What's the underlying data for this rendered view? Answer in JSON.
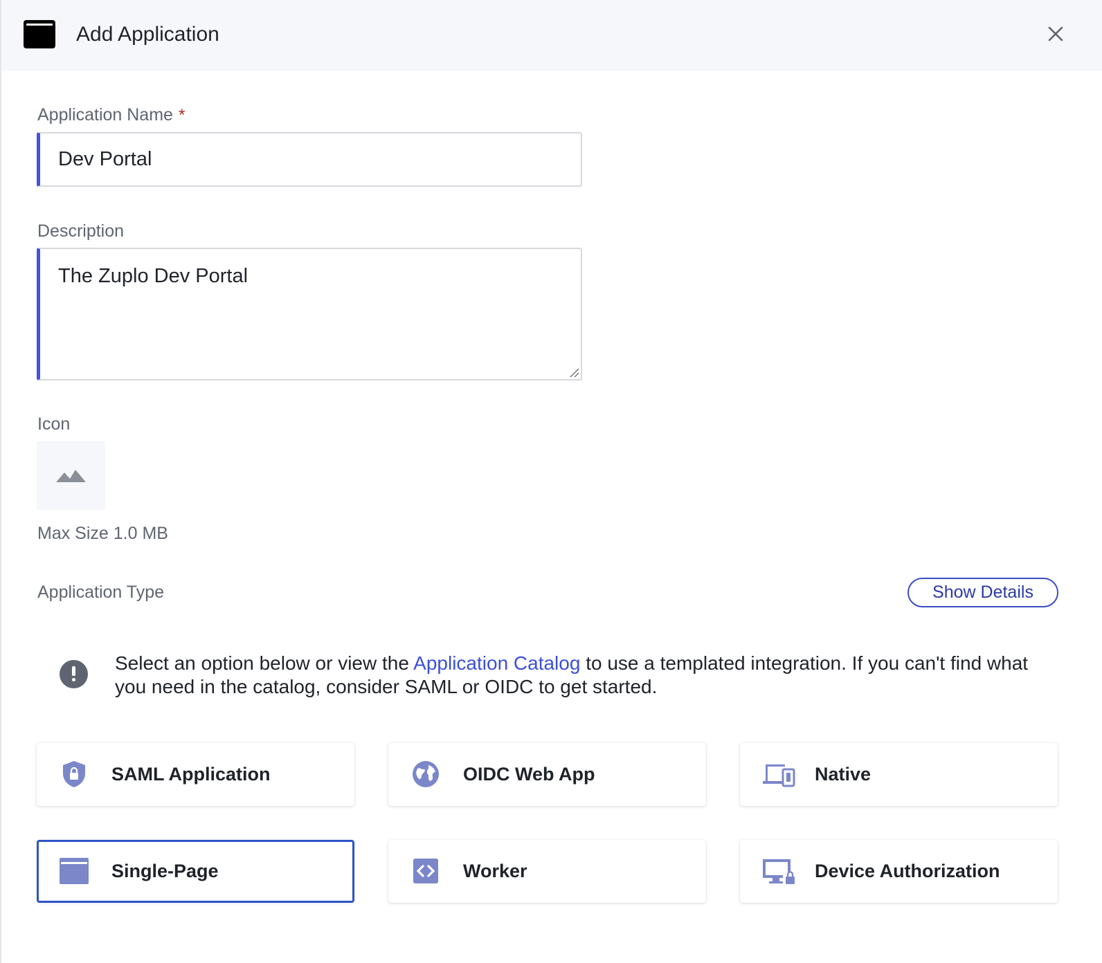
{
  "header": {
    "title": "Add Application"
  },
  "form": {
    "app_name": {
      "label": "Application Name",
      "required_mark": "*",
      "value": "Dev Portal"
    },
    "description": {
      "label": "Description",
      "value": "The Zuplo Dev Portal"
    },
    "icon": {
      "label": "Icon",
      "max_size": "Max Size 1.0 MB"
    },
    "app_type": {
      "label": "Application Type",
      "show_details": "Show Details",
      "notice_before": "Select an option below or view the ",
      "notice_link": "Application Catalog",
      "notice_after": " to use a templated integration. If you can't find what you need in the catalog, consider SAML or OIDC to get started.",
      "options": [
        {
          "label": "SAML Application",
          "icon": "shield-lock-icon",
          "selected": false
        },
        {
          "label": "OIDC Web App",
          "icon": "globe-icon",
          "selected": false
        },
        {
          "label": "Native",
          "icon": "devices-icon",
          "selected": false
        },
        {
          "label": "Single-Page",
          "icon": "browser-window-icon",
          "selected": true
        },
        {
          "label": "Worker",
          "icon": "code-icon",
          "selected": false
        },
        {
          "label": "Device Authorization",
          "icon": "monitor-lock-icon",
          "selected": false
        }
      ]
    }
  },
  "colors": {
    "accent": "#4553d9",
    "icon_fill": "#7b87c9",
    "link": "#3c4fd6",
    "selected_border": "#2c54c7"
  }
}
